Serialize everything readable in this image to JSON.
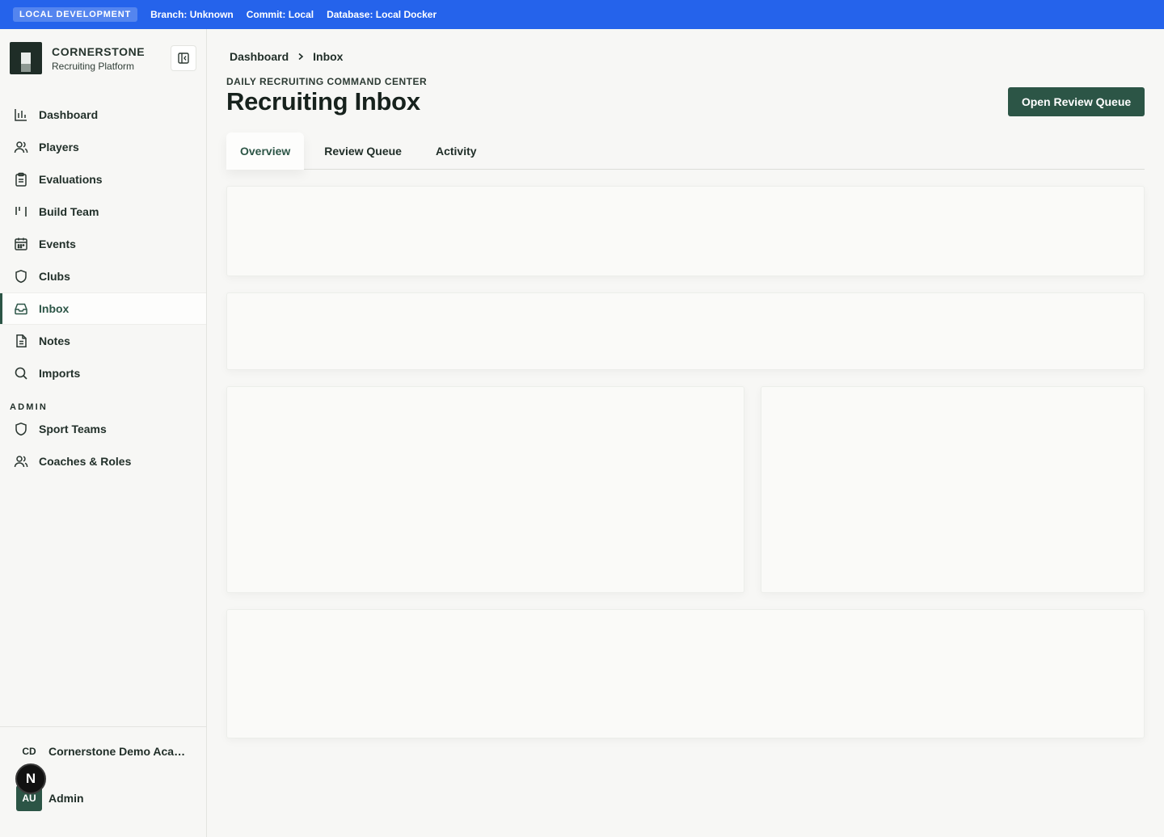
{
  "env_bar": {
    "badge": "LOCAL DEVELOPMENT",
    "branch": "Branch: Unknown",
    "commit": "Commit: Local",
    "database": "Database: Local Docker"
  },
  "sidebar": {
    "brand_name": "CORNERSTONE",
    "brand_sub": "Recruiting Platform",
    "items": [
      {
        "label": "Dashboard",
        "icon": "bar-chart-icon"
      },
      {
        "label": "Players",
        "icon": "users-icon"
      },
      {
        "label": "Evaluations",
        "icon": "clipboard-icon"
      },
      {
        "label": "Build Team",
        "icon": "columns-icon"
      },
      {
        "label": "Events",
        "icon": "calendar-icon"
      },
      {
        "label": "Clubs",
        "icon": "shield-icon"
      },
      {
        "label": "Inbox",
        "icon": "inbox-icon",
        "active": true
      },
      {
        "label": "Notes",
        "icon": "file-text-icon"
      },
      {
        "label": "Imports",
        "icon": "search-icon"
      }
    ],
    "admin_label": "ADMIN",
    "admin_items": [
      {
        "label": "Sport Teams",
        "icon": "shield-icon"
      },
      {
        "label": "Coaches & Roles",
        "icon": "users-icon"
      }
    ],
    "org_initials": "CD",
    "org_name": "Cornerstone Demo Academy",
    "user_initials": "AU",
    "user_name": "Admin",
    "next_badge": "N"
  },
  "header": {
    "breadcrumb": [
      "Dashboard",
      "Inbox"
    ],
    "eyebrow": "DAILY RECRUITING COMMAND CENTER",
    "title": "Recruiting Inbox",
    "primary_action": "Open Review Queue"
  },
  "tabs": [
    {
      "label": "Overview",
      "active": true
    },
    {
      "label": "Review Queue"
    },
    {
      "label": "Activity"
    }
  ],
  "colors": {
    "env_bar": "#2563eb",
    "accent": "#2c5546",
    "background": "#f7f7f5"
  }
}
